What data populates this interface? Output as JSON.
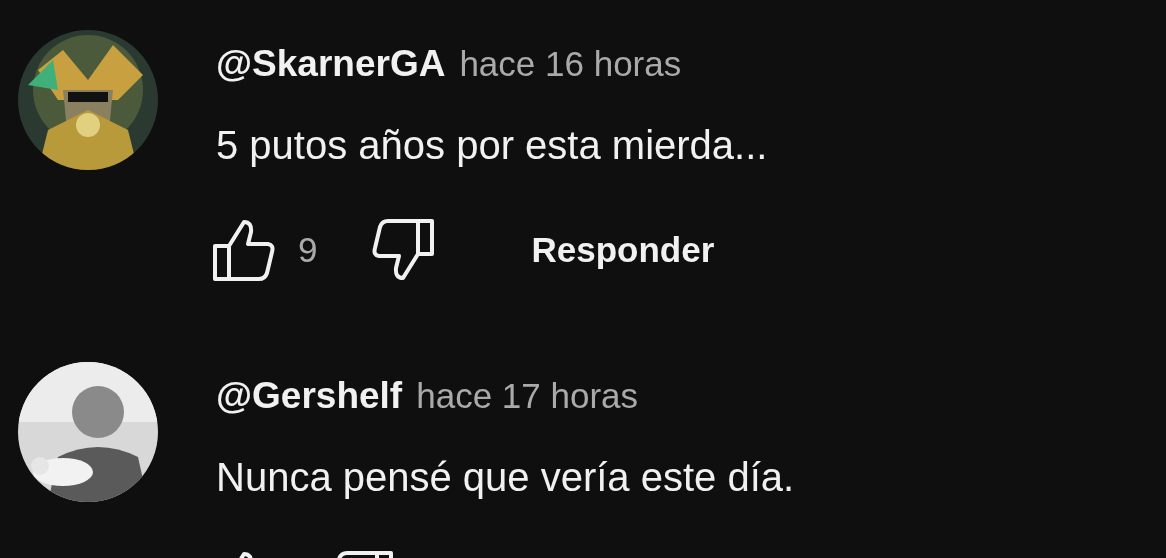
{
  "comments": [
    {
      "author": "@SkarnerGA",
      "time": "hace 16 horas",
      "text": "5 putos años por esta mierda...",
      "likes": "9",
      "reply": "Responder"
    },
    {
      "author": "@Gershelf",
      "time": "hace 17 horas",
      "text": "Nunca pensé que vería este día."
    }
  ]
}
